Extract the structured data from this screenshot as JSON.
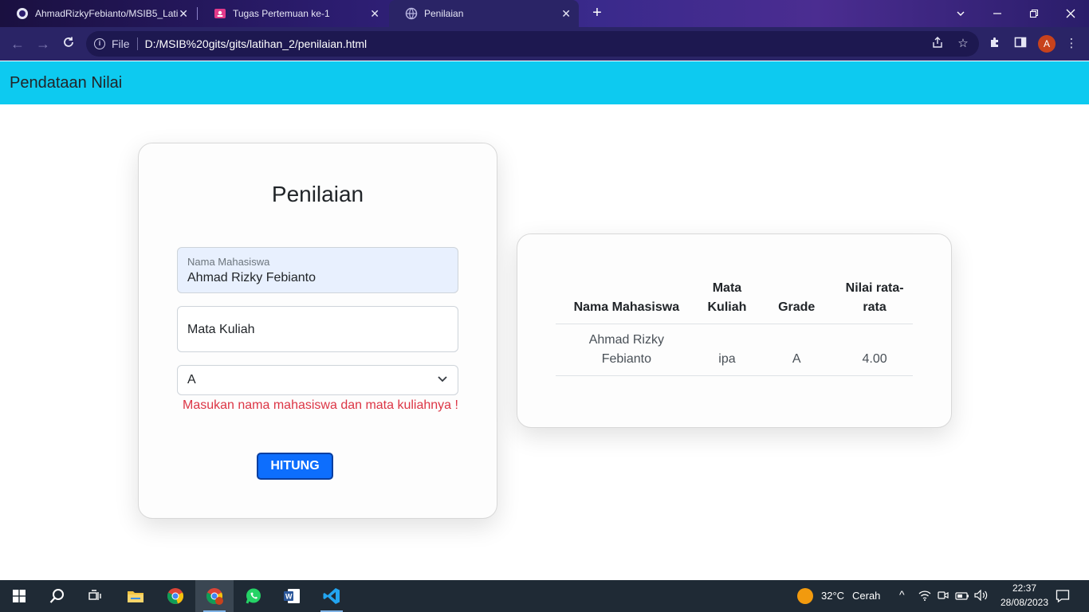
{
  "browser": {
    "tabs": [
      {
        "title": "AhmadRizkyFebianto/MSIB5_Lati",
        "icon": "github-icon",
        "active": false
      },
      {
        "title": "Tugas Pertemuan ke-1",
        "icon": "classroom-icon",
        "active": false
      },
      {
        "title": "Penilaian",
        "icon": "globe-icon",
        "active": true
      }
    ],
    "address": {
      "scheme": "File",
      "url": "D:/MSIB%20gits/gits/latihan_2/penilaian.html"
    },
    "profile_initial": "A"
  },
  "page": {
    "header_title": "Pendataan Nilai",
    "form": {
      "title": "Penilaian",
      "nama_label": "Nama Mahasiswa",
      "nama_value": "Ahmad Rizky Febianto",
      "matkul_placeholder": "Mata Kuliah",
      "grade_selected": "A",
      "error_message": "Masukan nama mahasiswa dan mata kuliahnya !",
      "submit_label": "HITUNG"
    },
    "table": {
      "headers": [
        "Nama Mahasiswa",
        "Mata Kuliah",
        "Grade",
        "Nilai rata-rata"
      ],
      "rows": [
        {
          "nama": "Ahmad Rizky Febianto",
          "matkul": "ipa",
          "grade": "A",
          "nilai": "4.00"
        }
      ]
    }
  },
  "taskbar": {
    "weather": {
      "temp": "32°C",
      "condition": "Cerah"
    },
    "time": "22:37",
    "date": "28/08/2023"
  },
  "colors": {
    "header_bg": "#0dcaf0",
    "button_bg": "#0d6efd",
    "error_text": "#dc3545"
  }
}
